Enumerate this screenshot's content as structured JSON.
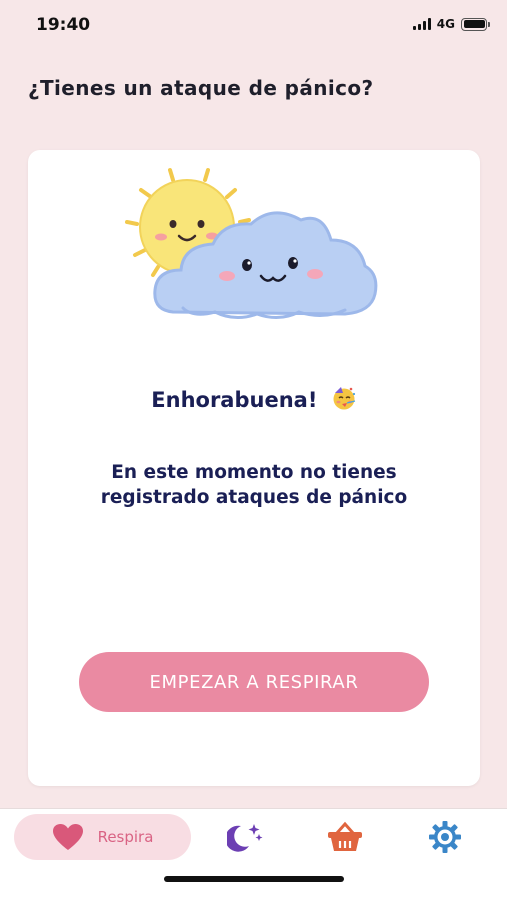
{
  "status_bar": {
    "time": "19:40",
    "network": "4G"
  },
  "header": {
    "title": "¿Tienes un ataque de pánico?"
  },
  "card": {
    "illustration": "sun-and-cloud-illustration",
    "congrats_text": "Enhorabuena!",
    "congrats_emoji": "party-face-emoji",
    "message": "En este momento no tienes registrado ataques de pánico",
    "button_label": "EMPEZAR A RESPIRAR"
  },
  "tab_bar": {
    "tabs": [
      {
        "label": "Respira",
        "icon": "heart-icon",
        "active": true
      },
      {
        "label": "",
        "icon": "moon-stars-icon",
        "active": false
      },
      {
        "label": "",
        "icon": "basket-icon",
        "active": false
      },
      {
        "label": "",
        "icon": "gear-icon",
        "active": false
      }
    ]
  },
  "colors": {
    "background": "#f7e7e8",
    "accent_pink": "#ea8aa2",
    "tab_active_bg": "#f8dde3",
    "heart": "#d9587a",
    "moon": "#6c3fb3",
    "basket": "#e0653f",
    "gear": "#3a86c8",
    "text_dark": "#1a1f55"
  }
}
